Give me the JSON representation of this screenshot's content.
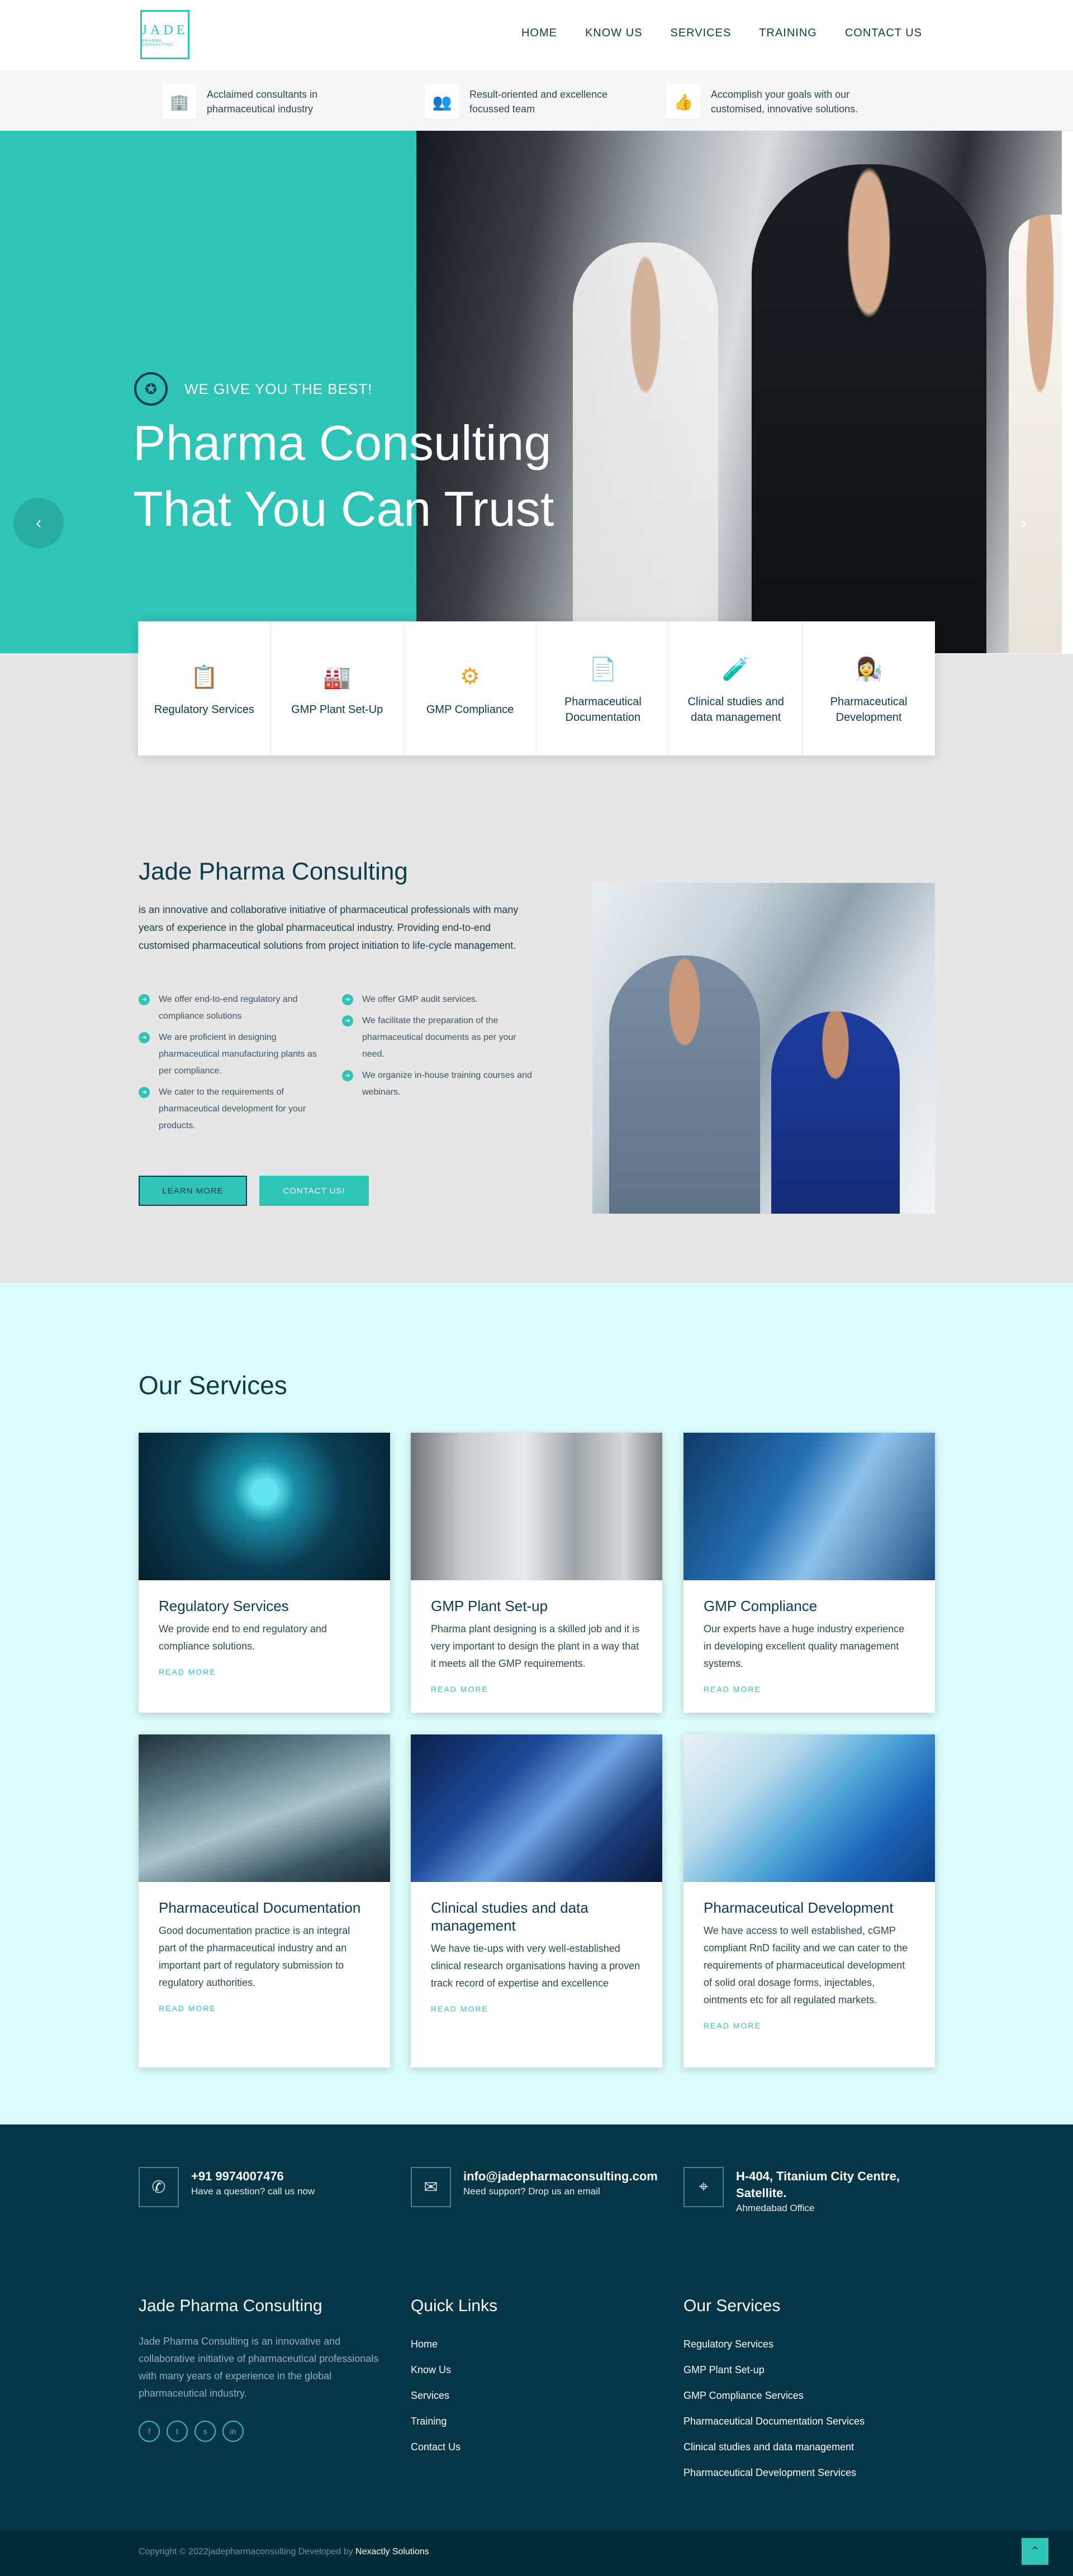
{
  "brand": {
    "name": "JADE",
    "tagline": "PHARMA CONSULTING"
  },
  "nav": [
    "HOME",
    "KNOW US",
    "SERVICES",
    "TRAINING",
    "CONTACT US"
  ],
  "features": [
    {
      "icon": "building-icon",
      "text": "Acclaimed consultants in pharmaceutical industry"
    },
    {
      "icon": "team-icon",
      "text": "Result-oriented and excellence focussed team"
    },
    {
      "icon": "thumbs-up-icon",
      "text": "Accomplish your goals with our customised, innovative solutions."
    }
  ],
  "hero": {
    "sub": "WE GIVE YOU THE BEST!",
    "title_l1": "Pharma Consulting",
    "title_l2": "That You Can Trust",
    "prev": "‹",
    "next": "›"
  },
  "quick_services": [
    "Regulatory Services",
    "GMP Plant Set-Up",
    "GMP Compliance",
    "Pharmaceutical Documentation",
    "Clinical studies and data management",
    "Pharmaceutical Development"
  ],
  "about": {
    "title": "Jade Pharma Consulting",
    "intro": "is an innovative and collaborative initiative of pharmaceutical professionals with many years of experience in the global pharmaceutical industry. Providing end-to-end customised pharmaceutical solutions from project initiation to life-cycle management.",
    "list_left": [
      "We offer end-to-end regulatory and compliance solutions",
      "We are proficient in designing pharmaceutical manufacturing plants as per compliance.",
      "We cater to the requirements of pharmaceutical development for your products."
    ],
    "list_right": [
      "We offer GMP audit services.",
      "We facilitate the preparation of the pharmaceutical documents as per your need.",
      "We organize in-house training courses and webinars."
    ],
    "learn": "LEARN MORE",
    "contact": "CONTACT US!"
  },
  "services": {
    "title": "Our Services",
    "read_more": "READ MORE",
    "items": [
      {
        "title": "Regulatory Services",
        "text": "We provide end to end regulatory and compliance solutions."
      },
      {
        "title": "GMP Plant Set-up",
        "text": "Pharma plant designing is a skilled job and it is very important to design the plant in a way that it meets all the GMP requirements."
      },
      {
        "title": "GMP Compliance",
        "text": "Our experts have a huge industry experience in developing excellent quality management systems."
      },
      {
        "title": "Pharmaceutical Documentation",
        "text": "Good documentation practice is an integral part of the pharmaceutical industry and an important part of regulatory submission to regulatory authorities."
      },
      {
        "title": "Clinical studies and data management",
        "text": "We have tie-ups with very well-established clinical research organisations having a proven track record of expertise and excellence"
      },
      {
        "title": "Pharmaceutical Development",
        "text": "We have access to well established, cGMP compliant RnD facility and we can cater to the requirements of pharmaceutical development of solid oral dosage forms, injectables, ointments etc for all regulated markets."
      }
    ]
  },
  "contact": {
    "phone": "+91 9974007476",
    "phone_sub": "Have a question? call us now",
    "email": "info@jadepharmaconsulting.com",
    "email_sub": "Need support? Drop us an email",
    "address": "H-404, Titanium City Centre, Satellite.",
    "address_sub": "Ahmedabad Office"
  },
  "footer": {
    "about_title": "Jade Pharma Consulting",
    "about_text": "Jade Pharma Consulting is an innovative and collaborative initiative of pharmaceutical professionals with many years of experience in the global pharmaceutical industry.",
    "links_title": "Quick Links",
    "links": [
      "Home",
      "Know Us",
      "Services",
      "Training",
      "Contact Us"
    ],
    "svc_title": "Our Services",
    "svc_links": [
      "Regulatory Services",
      "GMP Plant Set-up",
      "GMP Compliance Services",
      "Pharmaceutical Documentation Services",
      "Clinical studies and data management",
      "Pharmaceutical Development Services"
    ],
    "copy": "Copyright © 2022jadepharmaconsulting Developed by",
    "dev": "Nexactly Solutions"
  }
}
